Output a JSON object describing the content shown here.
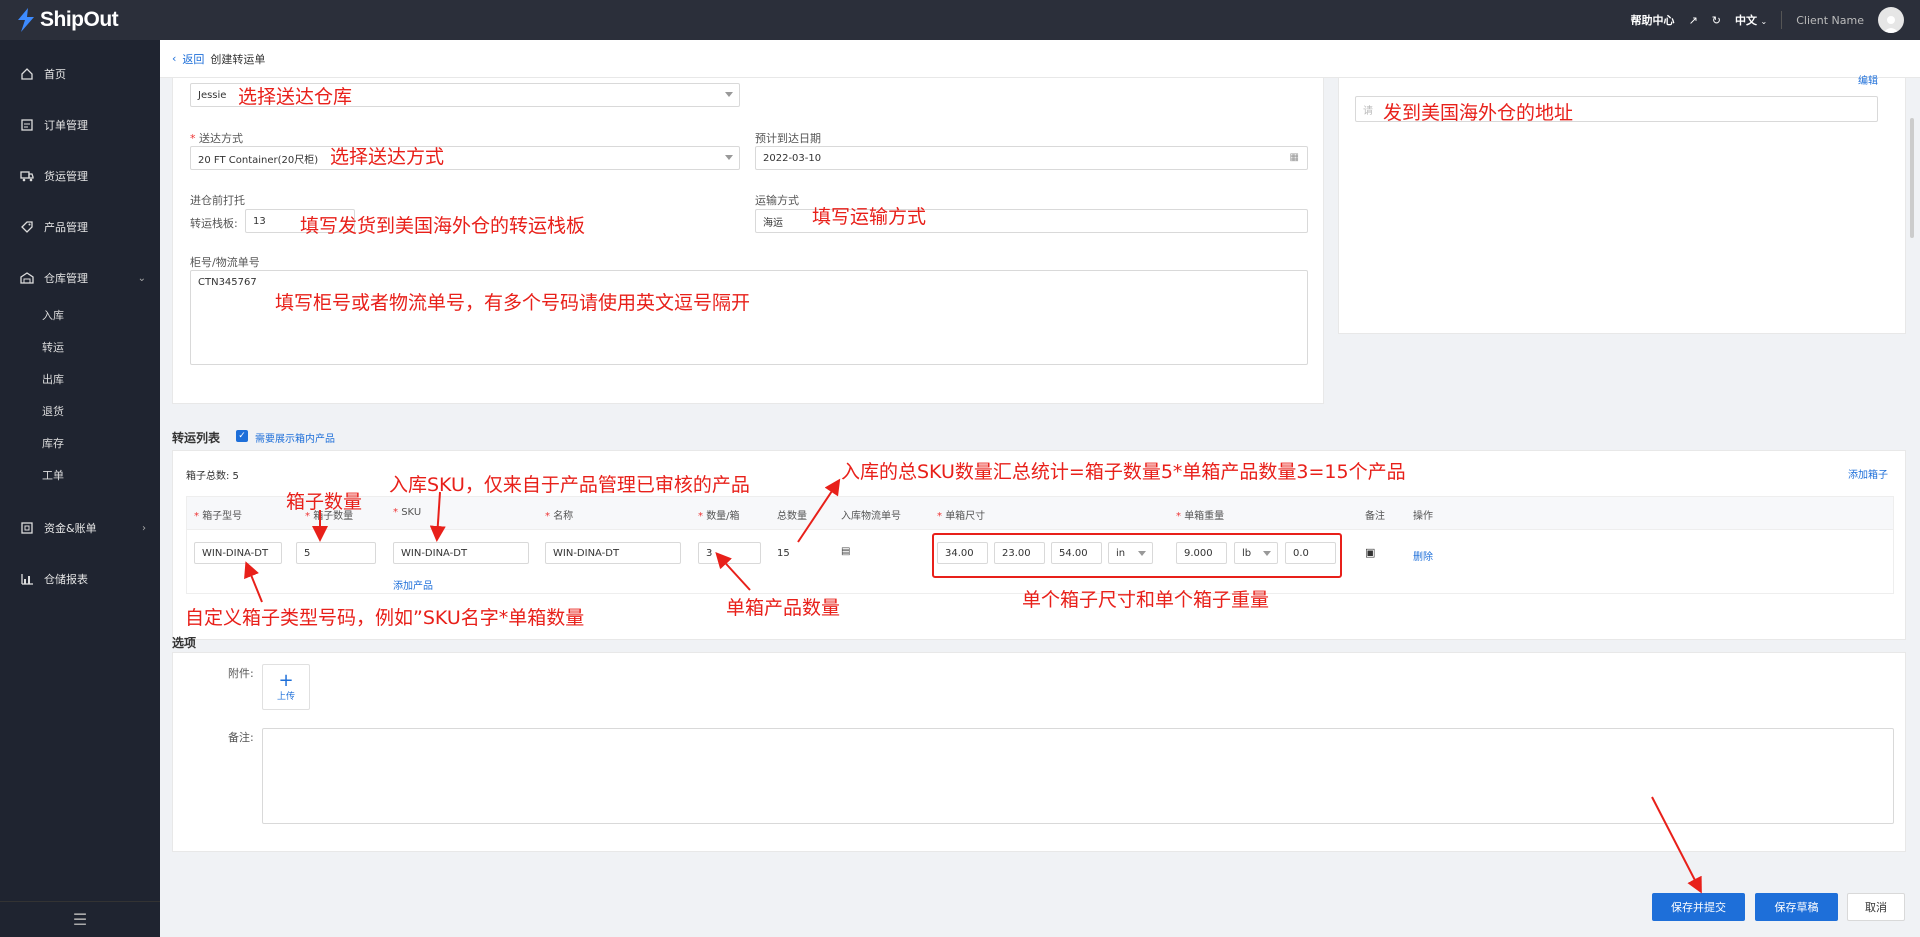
{
  "app": {
    "name": "ShipOut"
  },
  "topbar": {
    "help": "帮助中心",
    "language": "中文",
    "client_name": "Client Name"
  },
  "sidebar": {
    "items": [
      {
        "label": "首页"
      },
      {
        "label": "订单管理"
      },
      {
        "label": "货运管理"
      },
      {
        "label": "产品管理"
      },
      {
        "label": "仓库管理"
      },
      {
        "label": "资金&账单"
      },
      {
        "label": "仓储报表"
      }
    ],
    "warehouse_sub": [
      "入库",
      "转运",
      "出库",
      "退货",
      "库存",
      "工单"
    ]
  },
  "breadcrumb": {
    "back": "返回",
    "current": "创建转运单"
  },
  "form": {
    "warehouse_value": "Jessie",
    "ship_method_label": "送达方式",
    "ship_method_value": "20 FT Container(20尺柜)",
    "eta_label": "预计到达日期",
    "eta_value": "2022-03-10",
    "pallet_section_label": "进仓前打托",
    "pallet_label": "转运栈板:",
    "pallet_value": "13",
    "transport_label": "运输方式",
    "transport_value": "海运",
    "container_label": "柜号/物流单号",
    "container_value": "CTN345767",
    "address_edit": "编辑",
    "address_placeholder": "请"
  },
  "transfer_list": {
    "title": "转运列表",
    "show_products_label": "需要展示箱内产品",
    "box_total": "箱子总数: 5",
    "add_box": "添加箱子",
    "headers": [
      "箱子型号",
      "箱子数量",
      "SKU",
      "名称",
      "数量/箱",
      "总数量",
      "入库物流单号",
      "单箱尺寸",
      "单箱重量",
      "备注",
      "操作"
    ],
    "row": {
      "box_type": "WIN-DINA-DT",
      "box_qty": "5",
      "sku": "WIN-DINA-DT",
      "name": "WIN-DINA-DT",
      "qty_per_box": "3",
      "total_qty": "15",
      "length": "34.00",
      "width": "23.00",
      "height": "54.00",
      "dim_unit": "in",
      "weight": "9.000",
      "weight_unit": "lb",
      "weight_extra": "0.0",
      "delete": "删除"
    },
    "add_product": "添加产品"
  },
  "options": {
    "title": "选项",
    "attachment_label": "附件:",
    "upload_label": "上传",
    "remark_label": "备注:"
  },
  "actions": {
    "save_submit": "保存并提交",
    "save_draft": "保存草稿",
    "cancel": "取消"
  },
  "annotations": {
    "warehouse": "选择送达仓库",
    "ship_method": "选择送达方式",
    "pallet": "填写发货到美国海外仓的转运栈板",
    "transport": "填写运输方式",
    "container": "填写柜号或者物流单号，有多个号码请使用英文逗号隔开",
    "address": "发到美国海外仓的地址",
    "box_qty": "箱子数量",
    "sku": "入库SKU，仅来自于产品管理已审核的产品",
    "total": "入库的总SKU数量汇总统计=箱子数量5*单箱产品数量3=15个产品",
    "box_type": "自定义箱子类型号码，例如”SKU名字*单箱数量",
    "per_box": "单箱产品数量",
    "dims": "单个箱子尺寸和单个箱子重量"
  },
  "colors": {
    "sidebar": "#1f2430",
    "topbar": "#2b2f3a",
    "primary": "#1e6fd9",
    "annotation": "#e8201a"
  }
}
